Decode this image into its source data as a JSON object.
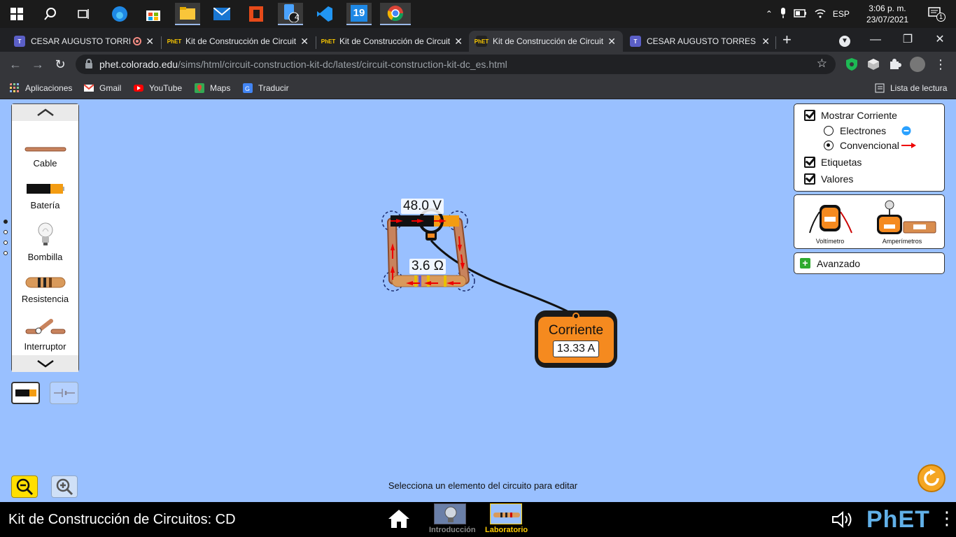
{
  "taskbar": {
    "pinned_icons": [
      "windows-start-icon",
      "search-icon",
      "task-view-icon",
      "edge-icon",
      "store-icon",
      "file-explorer-icon",
      "mail-icon",
      "office-icon",
      "phone-link-icon",
      "vscode-icon",
      "app-19-icon",
      "chrome-icon"
    ],
    "phone_badge": "4",
    "app19_label": "19",
    "tray": {
      "language": "ESP",
      "time": "3:06 p. m.",
      "date": "23/07/2021",
      "notifications": "1"
    }
  },
  "browser": {
    "tabs": [
      {
        "title": "CESAR AUGUSTO TORRES",
        "active": false
      },
      {
        "title": "Kit de Construcción de Circuit",
        "active": false
      },
      {
        "title": "Kit de Construcción de Circuit",
        "active": false
      },
      {
        "title": "Kit de Construcción de Circuit",
        "active": true
      },
      {
        "title": "CESAR AUGUSTO TORRES OL",
        "active": false
      }
    ],
    "new_tab": "+",
    "url_host": "phet.colorado.edu",
    "url_path": "/sims/html/circuit-construction-kit-dc/latest/circuit-construction-kit-dc_es.html",
    "bookmarks": [
      "Aplicaciones",
      "Gmail",
      "YouTube",
      "Maps",
      "Traducir"
    ],
    "reading_list": "Lista de lectura"
  },
  "sim": {
    "toolbox": {
      "items": [
        {
          "label": "Cable",
          "icon": "wire-icon"
        },
        {
          "label": "Batería",
          "icon": "battery-icon"
        },
        {
          "label": "Bombilla",
          "icon": "bulb-icon"
        },
        {
          "label": "Resistencia",
          "icon": "resistor-icon"
        },
        {
          "label": "Interruptor",
          "icon": "switch-icon"
        }
      ]
    },
    "display_panel": {
      "show_current": "Mostrar Corriente",
      "electrons": "Electrones",
      "conventional": "Convencional",
      "labels": "Etiquetas",
      "values": "Valores"
    },
    "sensors": {
      "voltmeter": "Voltímetro",
      "ammeter": "Amperímetros"
    },
    "advanced": "Avanzado",
    "circuit": {
      "battery_voltage": "48.0 V",
      "resistance": "3.6 Ω"
    },
    "ammeter_probe": {
      "title": "Corriente",
      "reading": "13.33 A"
    },
    "status": "Selecciona un elemento del circuito para editar"
  },
  "navbar": {
    "title": "Kit de Construcción de Circuitos: CD",
    "screens": [
      "Introducción",
      "Laboratorio"
    ],
    "brand": "PhET",
    "colors": {
      "accent": "#ffcc00",
      "inactive": "#888888"
    }
  }
}
